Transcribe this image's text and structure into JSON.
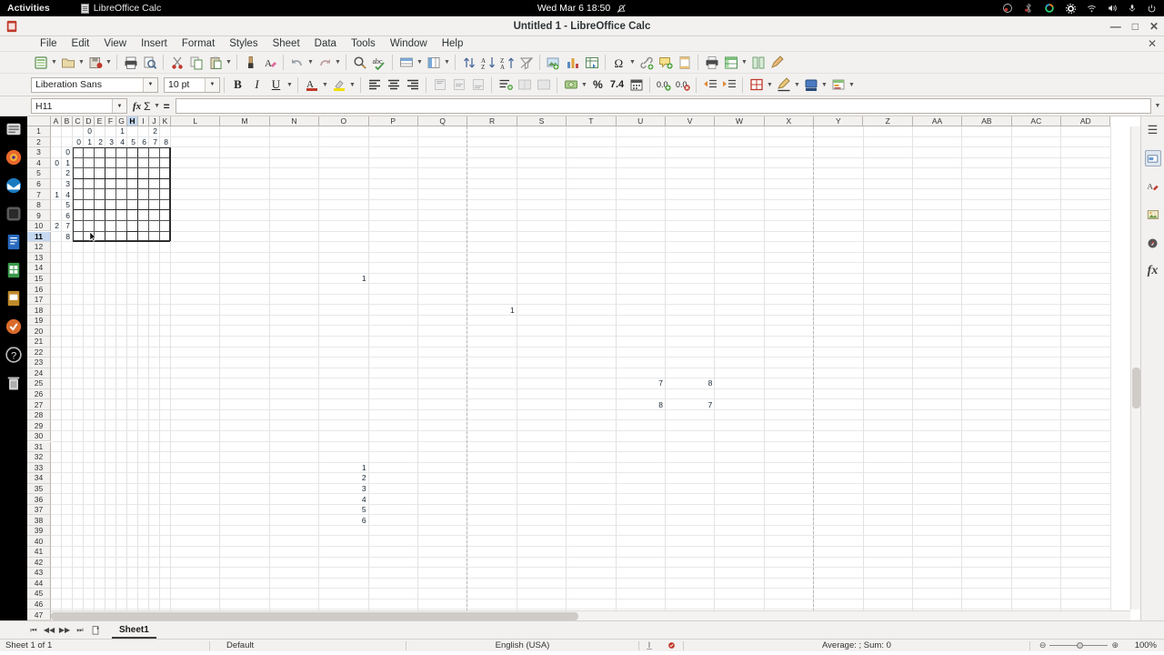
{
  "gnome": {
    "activities": "Activities",
    "app_name": "LibreOffice Calc",
    "clock": "Wed Mar 6  18:50",
    "tray_icons": [
      "screencast-icon",
      "bluetooth-icon",
      "color-ring-icon",
      "settings-gear-icon",
      "wifi-icon",
      "volume-icon",
      "microphone-icon",
      "power-icon"
    ]
  },
  "window": {
    "title": "Untitled 1 - LibreOffice Calc",
    "minimize": "—",
    "maximize": "□",
    "close": "✕",
    "close_document": "✕"
  },
  "menu": {
    "items": [
      "File",
      "Edit",
      "View",
      "Insert",
      "Format",
      "Styles",
      "Sheet",
      "Data",
      "Tools",
      "Window",
      "Help"
    ]
  },
  "toolbar_standard": {
    "icons": [
      "new-document-icon",
      "open-file-icon",
      "save-document-icon",
      "print-icon",
      "print-preview-icon",
      "cut-scissors-icon",
      "copy-icon",
      "paste-clipboard-icon",
      "clone-formatting-paintbrush-icon",
      "clear-formatting-icon",
      "undo-arrow-icon",
      "redo-arrow-icon",
      "find-and-replace-icon",
      "spelling-check-icon",
      "row-icon",
      "column-icon",
      "sort-icon",
      "sort-ascending-icon",
      "sort-descending-icon",
      "autofilter-funnel-icon",
      "insert-image-icon",
      "insert-chart-icon",
      "pivot-table-icon",
      "special-character-omega-icon",
      "insert-hyperlink-icon",
      "insert-comment-icon",
      "headers-footers-icon",
      "freeze-rows-columns-icon",
      "split-window-icon",
      "define-print-area-icon",
      "show-draw-functions-icon"
    ]
  },
  "toolbar_format": {
    "font_name": "Liberation Sans",
    "font_size": "10 pt",
    "bold": "B",
    "italic": "I",
    "underline": "U",
    "icons": [
      "font-color-icon",
      "highlighting-color-icon",
      "align-left-icon",
      "align-center-icon",
      "align-right-icon",
      "align-top-icon",
      "center-vertically-icon",
      "align-bottom-icon",
      "wrap-text-icon",
      "merge-cells-icon",
      "merge-and-center-icon",
      "format-as-currency-icon",
      "format-as-percent-icon",
      "format-as-number-icon",
      "format-as-date-icon",
      "add-decimal-place-icon",
      "delete-decimal-place-icon",
      "decrease-indent-icon",
      "increase-indent-icon",
      "borders-icon",
      "border-style-icon",
      "background-color-icon",
      "conditional-formatting-icon"
    ]
  },
  "formula_bar": {
    "name_box": "H11",
    "function_wizard": "fx",
    "sum_symbol": "Σ",
    "equals_symbol": "=",
    "input_value": "",
    "expand_label": "▼"
  },
  "left_launcher": {
    "icons": [
      "files-icon",
      "firefox-icon",
      "thunderbird-icon",
      "rhythmbox-icon",
      "libreoffice-writer-icon",
      "libreoffice-calc-icon",
      "libreoffice-impress-icon",
      "ubuntu-software-icon",
      "help-icon",
      "trash-icon"
    ]
  },
  "sidebar": {
    "icons": [
      "sidebar-settings-icon",
      "properties-icon",
      "styles-icon",
      "gallery-icon",
      "navigator-icon",
      "functions-icon"
    ]
  },
  "sheet": {
    "column_headers": [
      "A",
      "B",
      "C",
      "D",
      "E",
      "F",
      "G",
      "H",
      "I",
      "J",
      "K",
      "L",
      "M",
      "N",
      "O",
      "P",
      "Q",
      "R",
      "S",
      "T",
      "U",
      "V",
      "W",
      "X",
      "Y",
      "Z",
      "AA",
      "AB",
      "AC",
      "AD"
    ],
    "selected_column": "H",
    "row_count": 47,
    "selected_row": 11,
    "active_cell": "H11",
    "cells": [
      {
        "col": "D",
        "row": 1,
        "value": "0"
      },
      {
        "col": "G",
        "row": 1,
        "value": "1"
      },
      {
        "col": "J",
        "row": 1,
        "value": "2"
      },
      {
        "col": "C",
        "row": 2,
        "value": "0"
      },
      {
        "col": "D",
        "row": 2,
        "value": "1"
      },
      {
        "col": "E",
        "row": 2,
        "value": "2"
      },
      {
        "col": "F",
        "row": 2,
        "value": "3"
      },
      {
        "col": "G",
        "row": 2,
        "value": "4"
      },
      {
        "col": "H",
        "row": 2,
        "value": "5"
      },
      {
        "col": "I",
        "row": 2,
        "value": "6"
      },
      {
        "col": "J",
        "row": 2,
        "value": "7"
      },
      {
        "col": "K",
        "row": 2,
        "value": "8"
      },
      {
        "col": "B",
        "row": 3,
        "value": "0"
      },
      {
        "col": "B",
        "row": 4,
        "value": "1"
      },
      {
        "col": "B",
        "row": 5,
        "value": "2"
      },
      {
        "col": "B",
        "row": 6,
        "value": "3"
      },
      {
        "col": "B",
        "row": 7,
        "value": "4"
      },
      {
        "col": "B",
        "row": 8,
        "value": "5"
      },
      {
        "col": "B",
        "row": 9,
        "value": "6"
      },
      {
        "col": "B",
        "row": 10,
        "value": "7"
      },
      {
        "col": "B",
        "row": 11,
        "value": "8"
      },
      {
        "col": "A",
        "row": 4,
        "value": "0"
      },
      {
        "col": "A",
        "row": 7,
        "value": "1"
      },
      {
        "col": "A",
        "row": 10,
        "value": "2"
      },
      {
        "col": "O",
        "row": 15,
        "value": "1"
      },
      {
        "col": "R",
        "row": 18,
        "value": "1"
      },
      {
        "col": "U",
        "row": 25,
        "value": "7"
      },
      {
        "col": "V",
        "row": 25,
        "value": "8"
      },
      {
        "col": "U",
        "row": 27,
        "value": "8"
      },
      {
        "col": "V",
        "row": 27,
        "value": "7"
      },
      {
        "col": "O",
        "row": 33,
        "value": "1"
      },
      {
        "col": "O",
        "row": 34,
        "value": "2"
      },
      {
        "col": "O",
        "row": 35,
        "value": "3"
      },
      {
        "col": "O",
        "row": 36,
        "value": "4"
      },
      {
        "col": "O",
        "row": 37,
        "value": "5"
      },
      {
        "col": "O",
        "row": 38,
        "value": "6"
      }
    ]
  },
  "tabbar": {
    "first_sheet": "⏮",
    "prev_sheet": "◀◀",
    "next_sheet": "▶▶",
    "last_sheet": "⏭",
    "add_sheet": "+",
    "sheet_name": "Sheet1"
  },
  "statusbar": {
    "sheet_count": "Sheet 1 of 1",
    "page_style": "Default",
    "language": "English (USA)",
    "insert_mode": "insert-mode-icon",
    "selection_mode": "selection-mode-icon",
    "modified_indicator": "document-modified-icon",
    "signature": "",
    "summary": "Average: ; Sum: 0",
    "zoom_out": "⊖",
    "zoom_in": "⊕",
    "zoom_level": "100%"
  }
}
